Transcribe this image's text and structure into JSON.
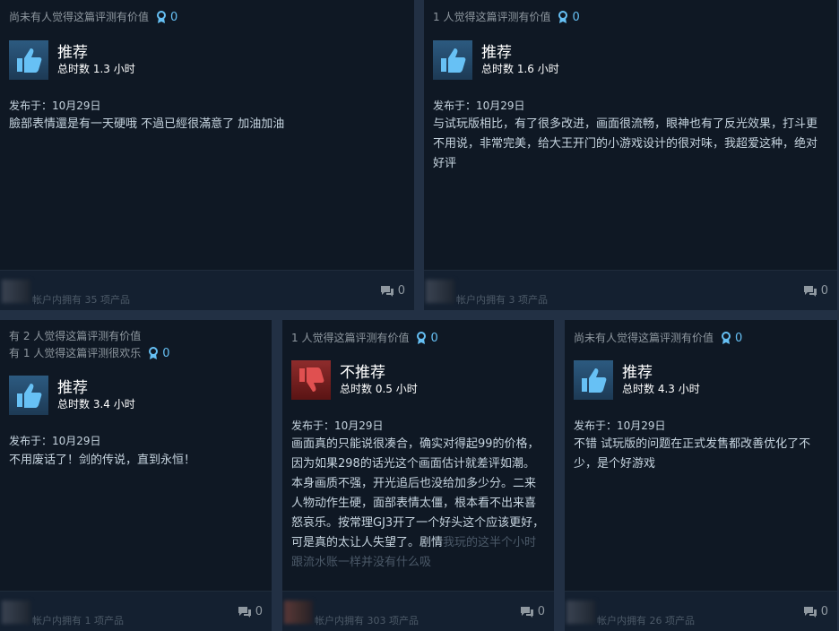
{
  "reviews": [
    {
      "helpful": "尚未有人觉得这篇评测有价值",
      "award_count": "0",
      "verdict": "推荐",
      "hours": "总时数 1.3 小时",
      "posted": "发布于：10月29日",
      "text": "臉部表情還是有一天硬哦 不過已經很滿意了 加油加油",
      "owned": "帐户内拥有 35 项产品",
      "comments": "0",
      "thumb": "thumbs-up"
    },
    {
      "helpful": "1 人觉得这篇评测有价值",
      "award_count": "0",
      "verdict": "推荐",
      "hours": "总时数 1.6 小时",
      "posted": "发布于：10月29日",
      "text": "与试玩版相比，有了很多改进，画面很流畅，眼神也有了反光效果，打斗更不用说，非常完美，给大王开门的小游戏设计的很对味，我超爱这种，绝对好评",
      "owned": "帐户内拥有 3 项产品",
      "comments": "0",
      "thumb": "thumbs-up"
    },
    {
      "helpful_line1": "有 2 人觉得这篇评测有价值",
      "helpful_line2": "有 1 人觉得这篇评测很欢乐",
      "award_count": "0",
      "verdict": "推荐",
      "hours": "总时数 3.4 小时",
      "posted": "发布于：10月29日",
      "text": "不用废话了！剑的传说，直到永恒！",
      "owned": "帐户内拥有 1 项产品",
      "comments": "0",
      "thumb": "thumbs-up"
    },
    {
      "helpful": "1 人觉得这篇评测有价值",
      "award_count": "0",
      "verdict": "不推荐",
      "hours": "总时数 0.5 小时",
      "posted": "发布于：10月29日",
      "text": "画面真的只能说很凑合，确实对得起99的价格，因为如果298的话光这个画面估计就差评如潮。本身画质不强，开光追后也没给加多少分。二来人物动作生硬，面部表情太僵，根本看不出来喜怒哀乐。按常理GJ3开了一个好头这个应该更好，可是真的太让人失望了。剧情",
      "text_faded": "我玩的这半个小时跟流水账一样并没有什么吸",
      "owned": "帐户内拥有 303 项产品",
      "comments": "0",
      "thumb": "thumbs-down"
    },
    {
      "helpful": "尚未有人觉得这篇评测有价值",
      "award_count": "0",
      "verdict": "推荐",
      "hours": "总时数 4.3 小时",
      "posted": "发布于：10月29日",
      "text": "不错 试玩版的问题在正式发售都改善优化了不少，是个好游戏",
      "owned": "帐户内拥有 26 项产品",
      "comments": "0",
      "thumb": "thumbs-up"
    }
  ]
}
